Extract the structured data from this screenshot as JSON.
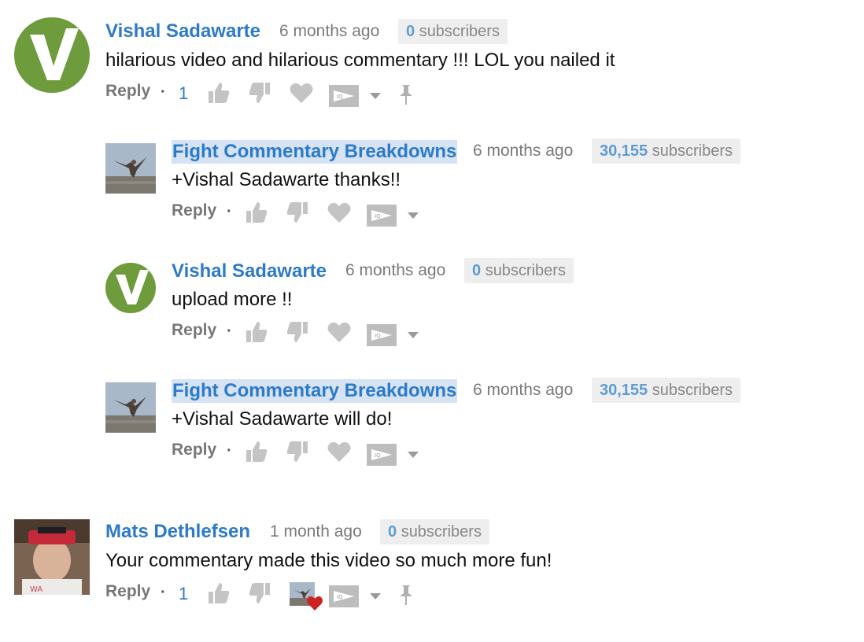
{
  "colors": {
    "author_link": "#2d7ac7",
    "subscriber_count": "#5d9bd6",
    "icon_gray": "#c4c4c4",
    "heart_red": "#cc2222",
    "avatar_green": "#6e9b3c"
  },
  "comments": [
    {
      "author": "Vishal Sadawarte",
      "time": "6 months ago",
      "subs_count": "0",
      "subs_label": "subscribers",
      "text": "hilarious video and hilarious commentary !!! LOL you nailed it",
      "reply_label": "Reply",
      "likes": "1",
      "avatar_icon": "v-logo-avatar"
    },
    {
      "author": "Fight Commentary Breakdowns",
      "time": "6 months ago",
      "subs_count": "30,155",
      "subs_label": "subscribers",
      "text": "+Vishal Sadawarte thanks!!",
      "reply_label": "Reply",
      "avatar_icon": "martial-artist-photo-avatar"
    },
    {
      "author": "Vishal Sadawarte",
      "time": "6 months ago",
      "subs_count": "0",
      "subs_label": "subscribers",
      "text": "upload more !!",
      "reply_label": "Reply",
      "avatar_icon": "v-logo-avatar"
    },
    {
      "author": "Fight Commentary Breakdowns",
      "time": "6 months ago",
      "subs_count": "30,155",
      "subs_label": "subscribers",
      "text": "+Vishal Sadawarte will do!",
      "reply_label": "Reply",
      "avatar_icon": "martial-artist-photo-avatar"
    },
    {
      "author": "Mats Dethlefsen",
      "time": "1 month ago",
      "subs_count": "0",
      "subs_label": "subscribers",
      "text": "Your commentary made this video so much more fun!",
      "reply_label": "Reply",
      "likes": "1",
      "avatar_icon": "user-photo-avatar",
      "creator_heart": true
    }
  ],
  "icons": {
    "like": "thumbs-up-icon",
    "dislike": "thumbs-down-icon",
    "heart": "heart-icon",
    "iq": "iq-flag-icon",
    "more": "chevron-down-icon",
    "pin": "pin-icon"
  }
}
